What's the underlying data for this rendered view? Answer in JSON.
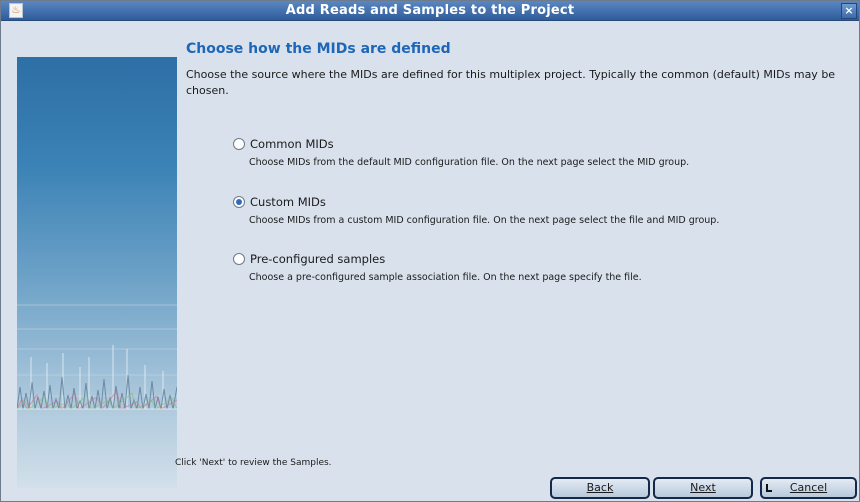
{
  "window": {
    "title": "Add Reads and Samples to the Project",
    "close_glyph": "×",
    "app_icon": "java-icon"
  },
  "page": {
    "heading": "Choose how the MIDs are defined",
    "intro": "Choose the source where the MIDs are defined for this multiplex project. Typically the common (default) MIDs may be chosen."
  },
  "options": [
    {
      "label": "Common MIDs",
      "description": "Choose MIDs from the default MID configuration file. On the next page select the MID group.",
      "selected": false
    },
    {
      "label": "Custom MIDs",
      "description": "Choose MIDs from a custom MID configuration file. On the next page select the file and MID group.",
      "selected": true
    },
    {
      "label": "Pre-configured samples",
      "description": "Choose a pre-configured sample association file. On the next page specify the file.",
      "selected": false
    }
  ],
  "footer": {
    "hint": "Click 'Next' to review the Samples."
  },
  "buttons": {
    "back_label": "Back",
    "next_label": "Next",
    "cancel_label": "Cancel"
  },
  "colors": {
    "heading": "#1e66b8",
    "titlebar": "#3d6aa6",
    "radio_selected": "#2f6bbf"
  }
}
